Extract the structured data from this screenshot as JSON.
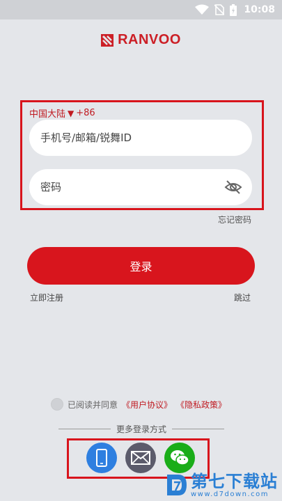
{
  "status_bar": {
    "time": "10:08"
  },
  "brand": {
    "name": "RANVOO",
    "color": "#cc1f26"
  },
  "login_form": {
    "region_label": "中国大陆",
    "region_arrow": "▼",
    "country_code": "+86",
    "account_placeholder": "手机号/邮箱/锐舞ID",
    "password_placeholder": "密码",
    "forgot_password": "忘记密码",
    "login_button": "登录",
    "register_link": "立即注册",
    "skip_link": "跳过"
  },
  "agreement": {
    "prefix": "已阅读并同意",
    "user_agreement": "《用户协议》",
    "privacy_policy": "《隐私政策》"
  },
  "alt_login": {
    "title": "更多登录方式",
    "options": [
      {
        "name": "phone-icon",
        "color": "#2e7fe0"
      },
      {
        "name": "mail-icon",
        "color": "#5b5b6b"
      },
      {
        "name": "wechat-icon",
        "color": "#1aad19"
      }
    ]
  },
  "watermark": {
    "text": "第七下载站",
    "url": "www.d7down.com"
  },
  "colors": {
    "accent": "#d8151d",
    "background": "#e4e6ea"
  }
}
